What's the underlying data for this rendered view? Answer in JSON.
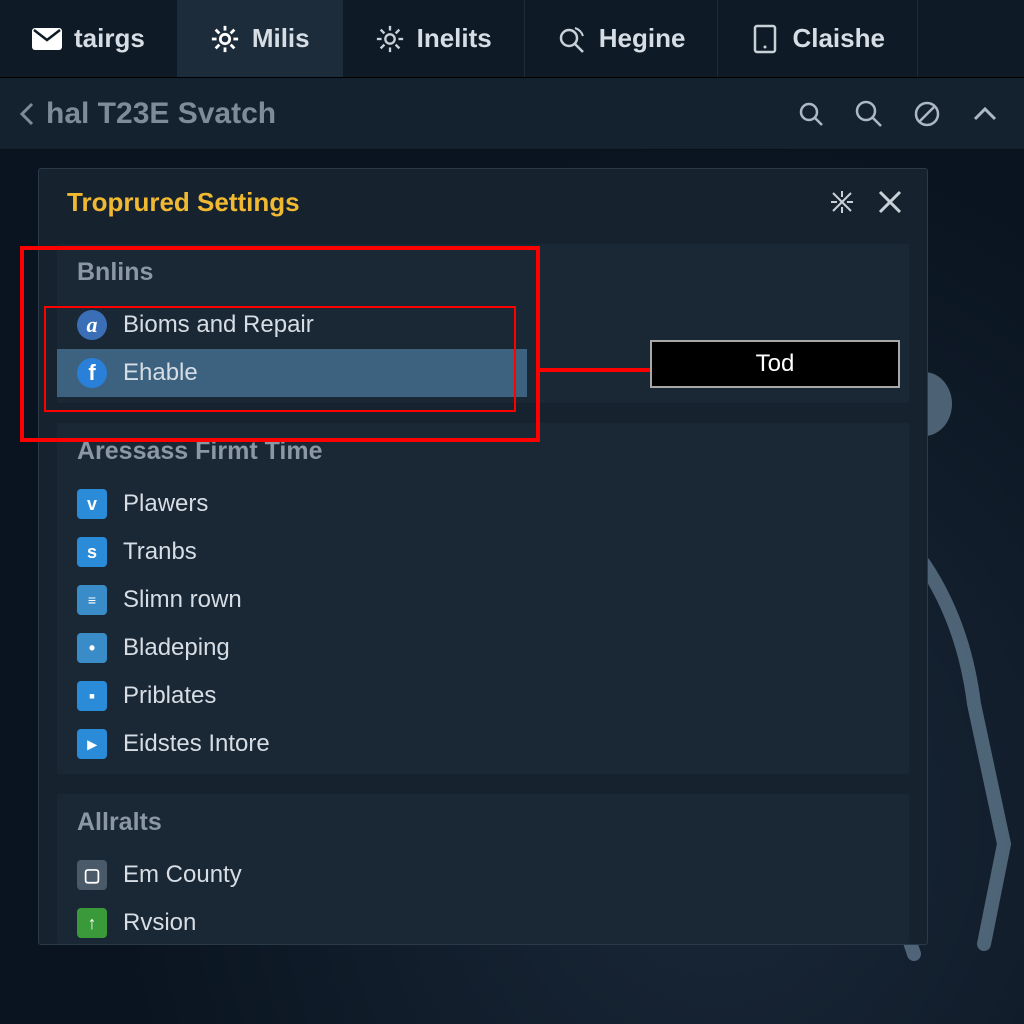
{
  "nav": {
    "tabs": [
      {
        "label": "tairgs",
        "icon": "mail"
      },
      {
        "label": "Milis",
        "icon": "gear",
        "active": true
      },
      {
        "label": "Inelits",
        "icon": "gear-outline"
      },
      {
        "label": "Hegine",
        "icon": "search-signal"
      },
      {
        "label": "Claishe",
        "icon": "tablet"
      }
    ]
  },
  "breadcrumb": {
    "back_label": "hal T23E Svatch"
  },
  "panel": {
    "title": "Troprured Settings"
  },
  "sections": {
    "bnlins": {
      "title": "Bnlins",
      "items": [
        {
          "label": "Bioms and Repair",
          "icon_letter": "a",
          "icon_bg": "#3a6fb8"
        },
        {
          "label": "Ehable",
          "icon_letter": "f",
          "icon_bg": "#2a7fd8",
          "selected": true
        }
      ]
    },
    "aressass": {
      "title": "Aressass Firmt Time",
      "items": [
        {
          "label": "Plawers",
          "icon_letter": "v",
          "icon_bg": "#2a8cd8"
        },
        {
          "label": "Tranbs",
          "icon_letter": "s",
          "icon_bg": "#2a8cd8"
        },
        {
          "label": "Slimn rown",
          "icon_letter": "≡",
          "icon_bg": "#3a8cc8"
        },
        {
          "label": "Bladeping",
          "icon_letter": "•",
          "icon_bg": "#3a8cc8"
        },
        {
          "label": "Priblates",
          "icon_letter": "▪",
          "icon_bg": "#2a8cd8"
        },
        {
          "label": "Eidstes Intore",
          "icon_letter": "▸",
          "icon_bg": "#2a8cd8"
        }
      ]
    },
    "allralts": {
      "title": "Allralts",
      "items": [
        {
          "label": "Em County",
          "icon_letter": "▢",
          "icon_bg": "#4a5a68"
        },
        {
          "label": "Rvsion",
          "icon_letter": "↑",
          "icon_bg": "#3a9a3a"
        }
      ]
    }
  },
  "callout": {
    "button_label": "Tod"
  }
}
